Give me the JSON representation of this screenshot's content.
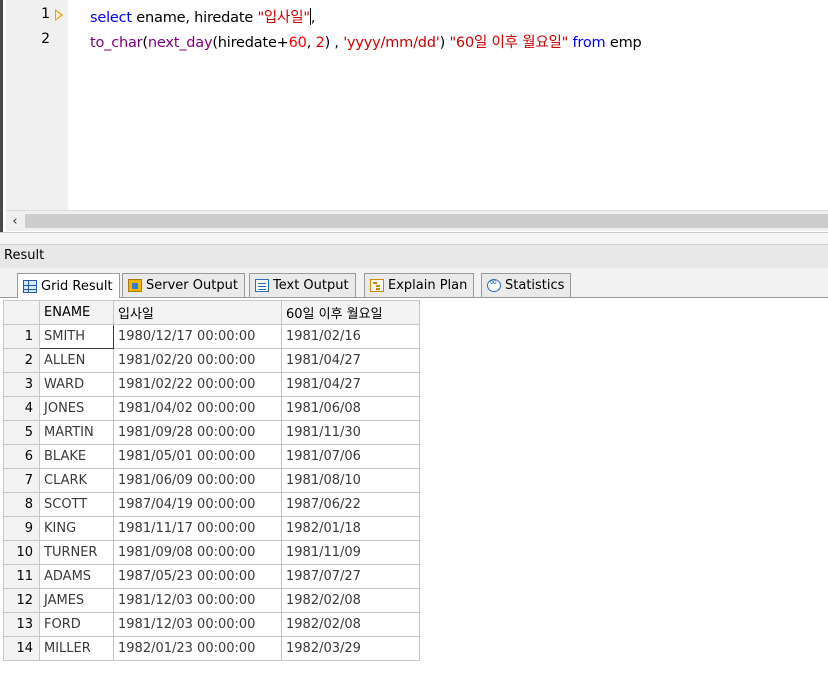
{
  "editor": {
    "line_numbers": [
      "1",
      "2"
    ],
    "line1": {
      "kw_select": "select",
      "plain": " ename, hiredate ",
      "alias": "\"입사일\"",
      "comma": ","
    },
    "line2": {
      "fn_to_char": "to_char",
      "p1": "(",
      "fn_next_day": "next_day",
      "p2": "(hiredate+",
      "n60": "60",
      "p3": ", ",
      "n2": "2",
      "p4": ") , ",
      "fmt": "'yyyy/mm/dd'",
      "p5": ") ",
      "alias": "\"60일 이후 월요일\"",
      "sp": " ",
      "kw_from": "from",
      "table": " emp"
    }
  },
  "result_panel": {
    "title": "Result",
    "tabs": [
      {
        "label": "Grid Result",
        "icon": "grid-icon",
        "active": true
      },
      {
        "label": "Server Output",
        "icon": "server-output-icon"
      },
      {
        "label": "Text Output",
        "icon": "text-output-icon"
      },
      {
        "label": "Explain Plan",
        "icon": "explain-plan-icon"
      },
      {
        "label": "Statistics",
        "icon": "statistics-icon"
      }
    ]
  },
  "grid": {
    "columns": [
      "ENAME",
      "입사일",
      "60일 이후 월요일"
    ],
    "rows": [
      {
        "n": "1",
        "ename": "SMITH",
        "hiredate": "1980/12/17 00:00:00",
        "monday": "1981/02/16"
      },
      {
        "n": "2",
        "ename": "ALLEN",
        "hiredate": "1981/02/20 00:00:00",
        "monday": "1981/04/27"
      },
      {
        "n": "3",
        "ename": "WARD",
        "hiredate": "1981/02/22 00:00:00",
        "monday": "1981/04/27"
      },
      {
        "n": "4",
        "ename": "JONES",
        "hiredate": "1981/04/02 00:00:00",
        "monday": "1981/06/08"
      },
      {
        "n": "5",
        "ename": "MARTIN",
        "hiredate": "1981/09/28 00:00:00",
        "monday": "1981/11/30"
      },
      {
        "n": "6",
        "ename": "BLAKE",
        "hiredate": "1981/05/01 00:00:00",
        "monday": "1981/07/06"
      },
      {
        "n": "7",
        "ename": "CLARK",
        "hiredate": "1981/06/09 00:00:00",
        "monday": "1981/08/10"
      },
      {
        "n": "8",
        "ename": "SCOTT",
        "hiredate": "1987/04/19 00:00:00",
        "monday": "1987/06/22"
      },
      {
        "n": "9",
        "ename": "KING",
        "hiredate": "1981/11/17 00:00:00",
        "monday": "1982/01/18"
      },
      {
        "n": "10",
        "ename": "TURNER",
        "hiredate": "1981/09/08 00:00:00",
        "monday": "1981/11/09"
      },
      {
        "n": "11",
        "ename": "ADAMS",
        "hiredate": "1987/05/23 00:00:00",
        "monday": "1987/07/27"
      },
      {
        "n": "12",
        "ename": "JAMES",
        "hiredate": "1981/12/03 00:00:00",
        "monday": "1982/02/08"
      },
      {
        "n": "13",
        "ename": "FORD",
        "hiredate": "1981/12/03 00:00:00",
        "monday": "1982/02/08"
      },
      {
        "n": "14",
        "ename": "MILLER",
        "hiredate": "1982/01/23 00:00:00",
        "monday": "1982/03/29"
      }
    ]
  }
}
